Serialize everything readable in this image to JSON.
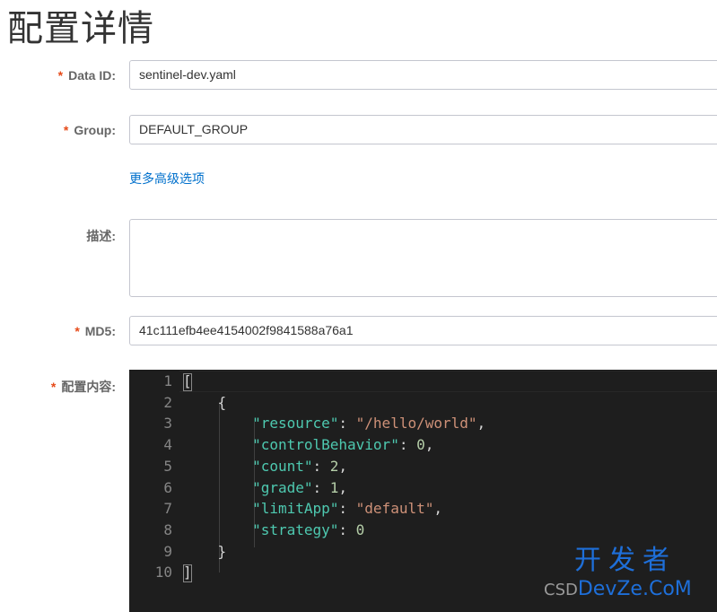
{
  "page": {
    "title": "配置详情"
  },
  "form": {
    "data_id": {
      "label": "Data ID:",
      "required": "*",
      "value": "sentinel-dev.yaml"
    },
    "group": {
      "label": "Group:",
      "required": "*",
      "value": "DEFAULT_GROUP"
    },
    "advanced_link": "更多高级选项",
    "description": {
      "label": "描述:",
      "value": ""
    },
    "md5": {
      "label": "MD5:",
      "required": "*",
      "value": "41c111efb4ee4154002f9841588a76a1"
    },
    "content": {
      "label": "配置内容:",
      "required": "*"
    }
  },
  "editor": {
    "line_numbers": [
      "1",
      "2",
      "3",
      "4",
      "5",
      "6",
      "7",
      "8",
      "9",
      "10"
    ],
    "lines": [
      [
        {
          "t": "[",
          "c": "punc"
        }
      ],
      [
        {
          "t": "    {",
          "c": "punc"
        }
      ],
      [
        {
          "t": "        ",
          "c": "punc"
        },
        {
          "t": "\"resource\"",
          "c": "key"
        },
        {
          "t": ": ",
          "c": "punc"
        },
        {
          "t": "\"/hello/world\"",
          "c": "str"
        },
        {
          "t": ",",
          "c": "punc"
        }
      ],
      [
        {
          "t": "        ",
          "c": "punc"
        },
        {
          "t": "\"controlBehavior\"",
          "c": "key"
        },
        {
          "t": ": ",
          "c": "punc"
        },
        {
          "t": "0",
          "c": "num"
        },
        {
          "t": ",",
          "c": "punc"
        }
      ],
      [
        {
          "t": "        ",
          "c": "punc"
        },
        {
          "t": "\"count\"",
          "c": "key"
        },
        {
          "t": ": ",
          "c": "punc"
        },
        {
          "t": "2",
          "c": "num"
        },
        {
          "t": ",",
          "c": "punc"
        }
      ],
      [
        {
          "t": "        ",
          "c": "punc"
        },
        {
          "t": "\"grade\"",
          "c": "key"
        },
        {
          "t": ": ",
          "c": "punc"
        },
        {
          "t": "1",
          "c": "num"
        },
        {
          "t": ",",
          "c": "punc"
        }
      ],
      [
        {
          "t": "        ",
          "c": "punc"
        },
        {
          "t": "\"limitApp\"",
          "c": "key"
        },
        {
          "t": ": ",
          "c": "punc"
        },
        {
          "t": "\"default\"",
          "c": "str"
        },
        {
          "t": ",",
          "c": "punc"
        }
      ],
      [
        {
          "t": "        ",
          "c": "punc"
        },
        {
          "t": "\"strategy\"",
          "c": "key"
        },
        {
          "t": ": ",
          "c": "punc"
        },
        {
          "t": "0",
          "c": "num"
        }
      ],
      [
        {
          "t": "    }",
          "c": "punc"
        }
      ],
      [
        {
          "t": "]",
          "c": "punc"
        }
      ]
    ],
    "colors": {
      "background": "#1e1e1e",
      "key": "#4ec9b0",
      "string": "#ce9178",
      "number": "#b5cea8",
      "gutter_text": "#858585"
    }
  },
  "watermark": {
    "cn": "开发者",
    "en_prefix": "CSD",
    "en_brand": "DevZe.CoM"
  }
}
